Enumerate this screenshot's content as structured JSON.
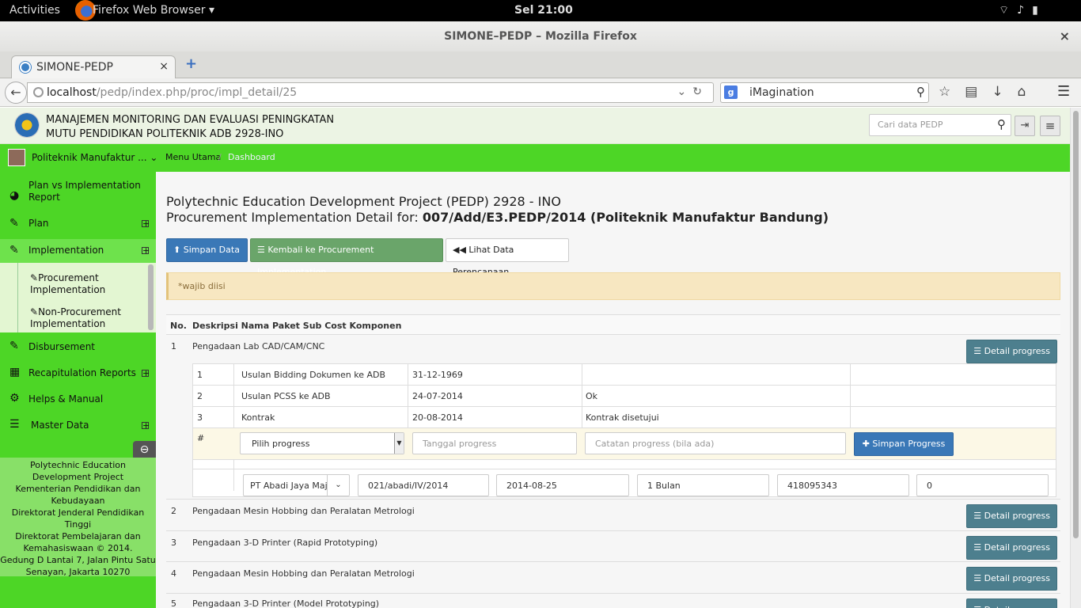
{
  "gnome": {
    "activities": "Activities",
    "app": "Firefox Web Browser ▾",
    "clock": "Sel 21:00",
    "sys_icons": "wifi-icon volume-icon battery-icon"
  },
  "window": {
    "title": "SIMONE–PEDP – Mozilla Firefox",
    "close": "×"
  },
  "tab": {
    "label": "SIMONE-PEDP",
    "close": "×",
    "new": "+"
  },
  "nav": {
    "url_host": "localhost",
    "url_path": "/pedp/index.php/proc/impl_detail/25",
    "search_value": "iMagination",
    "search_engine": "g"
  },
  "header": {
    "line1": "MANAJEMEN MONITORING DAN EVALUASI PENINGKATAN",
    "line2": "MUTU PENDIDIKAN POLITEKNIK ADB 2928-INO",
    "search_placeholder": "Cari data PEDP"
  },
  "topbar": {
    "institution": "Politeknik Manufaktur ...",
    "crumb_home": "Menu Utama",
    "crumb_sep": "/",
    "crumb_current": "Dashboard"
  },
  "sidebar": {
    "items": [
      {
        "label": "Plan vs Implementation Report",
        "icon": "dashboard-icon"
      },
      {
        "label": "Plan",
        "icon": "edit-icon"
      },
      {
        "label": "Implementation",
        "icon": "edit-icon"
      },
      {
        "label": "Disbursement",
        "icon": "edit-icon"
      },
      {
        "label": "Recapitulation Reports",
        "icon": "table-icon"
      },
      {
        "label": "Helps & Manual",
        "icon": "gear-icon"
      },
      {
        "label": "Master Data",
        "icon": "list-icon"
      }
    ],
    "sub": [
      "Procurement Implementation",
      "Non-Procurement Implementation"
    ],
    "footer": [
      "Polytechnic Education Development Project",
      "Kementerian Pendidikan dan Kebudayaan",
      "Direktorat Jenderal Pendidikan Tinggi",
      "Direktorat Pembelajaran dan Kemahasiswaan © 2014.",
      "Gedung D Lantai 7, Jalan Pintu Satu Senayan, Jakarta 10270"
    ]
  },
  "main": {
    "title": "Polytechnic Education Development Project (PEDP) 2928 - INO",
    "subtitle_prefix": "Procurement Implementation Detail for: ",
    "subtitle_bold": "007/Add/E3.PEDP/2014 (Politeknik Manufaktur Bandung)",
    "btn_save": "Simpan Data",
    "btn_back": "Kembali ke Procurement Implementation",
    "btn_plan": "Lihat Data Perencanaan",
    "alert": "*wajib diisi",
    "col_no": "No.",
    "col_desc": "Deskripsi Nama Paket Sub Cost Komponen",
    "detail_btn": "Detail progress",
    "rows": [
      {
        "no": "1",
        "desc": "Pengadaan Lab CAD/CAM/CNC"
      },
      {
        "no": "2",
        "desc": "Pengadaan Mesin Hobbing dan Peralatan Metrologi"
      },
      {
        "no": "3",
        "desc": "Pengadaan 3-D Printer (Rapid Prototyping)"
      },
      {
        "no": "4",
        "desc": "Pengadaan Mesin Hobbing dan Peralatan Metrologi"
      },
      {
        "no": "5",
        "desc": "Pengadaan 3-D Printer (Model Prototyping)"
      }
    ],
    "progress": [
      {
        "no": "1",
        "stage": "Usulan Bidding Dokumen ke ADB",
        "date": "31-12-1969",
        "note": ""
      },
      {
        "no": "2",
        "stage": "Usulan PCSS ke ADB",
        "date": "24-07-2014",
        "note": "Ok"
      },
      {
        "no": "3",
        "stage": "Kontrak",
        "date": "20-08-2014",
        "note": "Kontrak disetujui"
      }
    ],
    "form": {
      "hash": "#",
      "select": "Pilih progress",
      "date_ph": "Tanggal progress",
      "note_ph": "Catatan progress (bila ada)",
      "save": "Simpan Progress"
    },
    "contract": {
      "vendor": "PT Abadi Jaya Maj",
      "number": "021/abadi/IV/2014",
      "date": "2014-08-25",
      "duration": "1 Bulan",
      "value": "418095343",
      "extra": "0"
    }
  }
}
